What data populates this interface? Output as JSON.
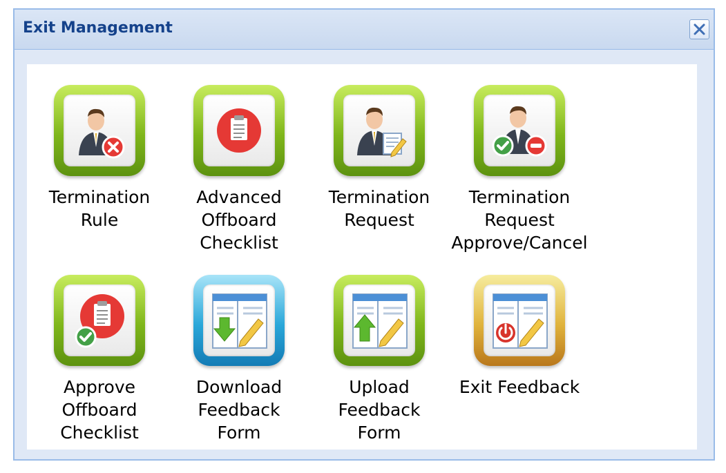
{
  "window": {
    "title": "Exit Management",
    "close_icon": "close-icon"
  },
  "tiles": [
    {
      "label_lines": [
        "Termination",
        "Rule"
      ],
      "icon": "termination-rule-icon",
      "color": "green"
    },
    {
      "label_lines": [
        "Advanced",
        "Offboard",
        "Checklist"
      ],
      "icon": "clipboard-icon",
      "color": "green"
    },
    {
      "label_lines": [
        "Termination",
        "Request"
      ],
      "icon": "termination-request-icon",
      "color": "green"
    },
    {
      "label_lines": [
        "Termination",
        "Request",
        "Approve/Cancel"
      ],
      "icon": "approve-cancel-icon",
      "color": "green"
    },
    {
      "label_lines": [
        "Approve",
        "Offboard",
        "Checklist"
      ],
      "icon": "approve-checklist-icon",
      "color": "green"
    },
    {
      "label_lines": [
        "Download",
        "Feedback",
        "Form"
      ],
      "icon": "download-form-icon",
      "color": "blue"
    },
    {
      "label_lines": [
        "Upload",
        "Feedback",
        "Form"
      ],
      "icon": "upload-form-icon",
      "color": "green"
    },
    {
      "label_lines": [
        "Exit Feedback"
      ],
      "icon": "exit-feedback-icon",
      "color": "gold"
    }
  ],
  "colors": {
    "title_text": "#15428b",
    "window_border": "#99bbe8",
    "window_bg": "#dfe8f6",
    "tile_green": "#7fb61b",
    "tile_blue": "#2aa7d9",
    "tile_gold": "#e0b33c",
    "badge_red": "#e53935",
    "badge_green": "#43a047"
  }
}
